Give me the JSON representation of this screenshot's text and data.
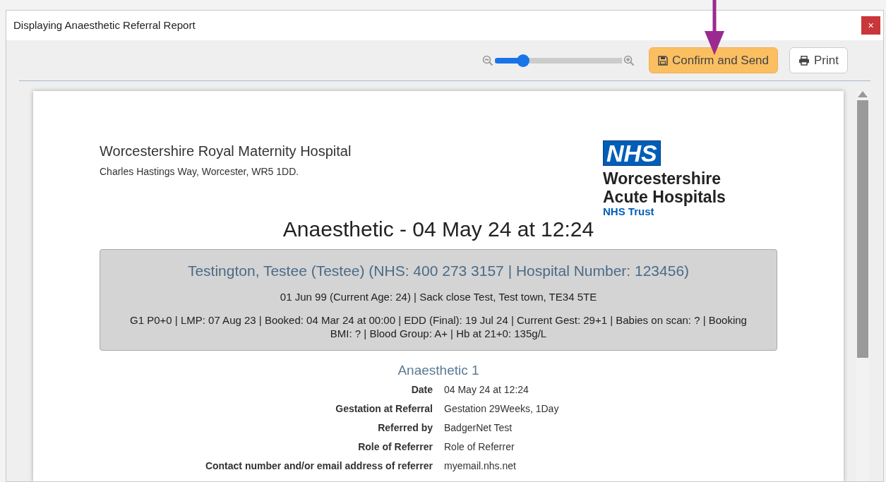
{
  "window": {
    "title": "Displaying Anaesthetic Referral Report",
    "close": "×"
  },
  "toolbar": {
    "zoom": {
      "level": 0.22
    },
    "buttons": [
      {
        "label": "Confirm and Send",
        "kind": "primary"
      },
      {
        "label": "Print",
        "kind": "secondary"
      }
    ]
  },
  "report": {
    "hospital": {
      "name": "Worcestershire Royal Maternity Hospital",
      "address": "Charles Hastings Way, Worcester, WR5 1DD."
    },
    "logo": {
      "badge": "NHS",
      "lines": [
        "Worcestershire",
        "Acute Hospitals"
      ],
      "subtitle": "NHS Trust"
    },
    "title": "Anaesthetic - 04 May 24 at 12:24",
    "patient": {
      "name": "Testington, Testee (Testee) (NHS: 400 273 3157 | Hospital Number: 123456)",
      "details": "01 Jun 99 (Current Age: 24) | Sack close Test, Test town, TE34 5TE",
      "summary": "G1 P0+0 | LMP: 07 Aug 23 | Booked: 04 Mar 24 at 00:00 | EDD (Final): 19 Jul 24 | Current Gest: 29+1 | Babies on scan: ? | Booking BMI: ? | Blood Group: A+ | Hb at 21+0: 135g/L"
    },
    "section": {
      "title": "Anaesthetic 1",
      "fields": [
        {
          "label": "Date",
          "value": "04 May 24 at 12:24"
        },
        {
          "label": "Gestation at Referral",
          "value": "Gestation 29Weeks, 1Day"
        },
        {
          "label": "Referred by",
          "value": "BadgerNet Test"
        },
        {
          "label": "Role of Referrer",
          "value": "Role of Referrer"
        },
        {
          "label": "Contact number and/or email address of referrer",
          "value": "myemail.nhs.net"
        }
      ]
    }
  }
}
